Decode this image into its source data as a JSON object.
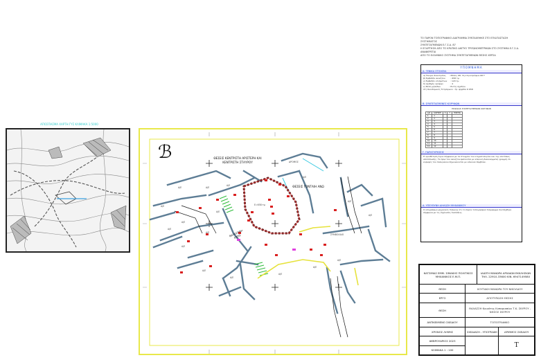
{
  "inset": {
    "title": "ΑΠΟΣΠΑΣΜΑ ΧΑΡΤΗ ΓΥΣ ΚΛΙΜΑΚΑ 1:5000"
  },
  "plan": {
    "north_arrow": "ℬ",
    "labels": {
      "area_west": "ΘΕΣΕΙΣ ΚΕΝΤΡΙΣΤΗ ΑΡΙΣΤΕΡΗ ΚΑΙ ΚΕΝΤΡΙΣΤΗ ΣΤΑΥΡΟΥ",
      "area_east": "ΘΕΣΕΙΣ ΓΟΝΤΑΙΗ ΑΝΩ",
      "street_south": "ΘΑΛΑΣΣΙΝΗ ΕΡΟΙΣ"
    }
  },
  "note_top": {
    "lines": [
      "ΤΟ ΠΑΡΟΝ ΤΟΠΟΓΡΑΦΙΚΟ ΔΙΑΓΡΑΜΜΑ ΣΥΝΤΑΧΘΗΚΕ ΣΤΟ ΕΓΚΑΤΑΣΤΑΣΗ ΣΥΣΤΗΜΑΤΟΣ",
      "ΣΥΝΤΕΤΑΓΜΕΝΩΝ Ε.Γ.Σ.Α. 87",
      "Η ΕΞΑΡΤΗΣΗ ΑΠΟ ΤΟ ΚΡΑΤΙΚΟ ΔΙΚΤΥΟ ΤΡΙΓΩΝΟΜΕΤΡΙΚΩΝ ΣΤΟ ΣΥΣΤΗΜΑ Ε.Γ.Σ.Α. ΑΝΑΦΕΡΕΤΑΙ",
      "ΑΠΟ ΤΟ ΕΛΛΗΝΙΚΟ ΣΥΣΤΗΜΑ ΣΥΝΤΕΤΑΓΜΕΝΩΝ ΘΕΣΗΣ ΧΕΡΣΑ"
    ]
  },
  "specs": {
    "title": "ΥΠΟΜΝΗΜΑ",
    "section1": "Α. ΓΕΝΙΚΑ ΣΤΟΙΧΕΙΑ",
    "section1_body": "α) Όνομα ιδιοκτησίας     : Μύλος 68, 3η κτηνοτρόφων 68 Τ\nβ) Εμβαδόν ακινήτου        : 658 τμ\nγ) Εμβαδόν κτισμάτων     : 120 τμ\nδ) Αριθμός ορόφων           : 2\nε) Θέση γηπέδου             : Εντός σχεδίου\nστ) Οικοδομικός Τετράγωνο : Γρ. ψηφίδα Ο 658",
    "section2": "Β. ΣΥΝΤΕΤΑΓΜΕΝΕΣ ΚΟΡΥΦΩΝ",
    "section2_sub": "ΠΙΝΑΚΑΣ ΣΥΝΤΕΤΑΓΜΕΝΩΝ ΚΟΡΥΦΩΝ",
    "coord_headers": [
      "Α/Α",
      "ΚΟΡΥΦΗ",
      "X",
      "Y",
      "ΠΛΕΥΡΑ"
    ],
    "coord_rows": [
      [
        "1",
        "1",
        "",
        "",
        ""
      ],
      [
        "2",
        "2",
        "",
        "",
        ""
      ],
      [
        "3",
        "3",
        "",
        "",
        ""
      ],
      [
        "4",
        "4",
        "",
        "",
        ""
      ],
      [
        "5",
        "5",
        "",
        "",
        ""
      ],
      [
        "6",
        "6",
        "",
        "",
        ""
      ],
      [
        "7",
        "7",
        "",
        "",
        ""
      ],
      [
        "8",
        "8",
        "",
        "",
        ""
      ],
      [
        "9",
        "9",
        "",
        "",
        ""
      ],
      [
        "10",
        "10",
        "",
        "",
        ""
      ],
      [
        "11",
        "11",
        "",
        "",
        ""
      ],
      [
        "12",
        "12",
        "",
        "",
        ""
      ]
    ],
    "section3": "Γ. ΠΑΡΑΤΗΡΗΣΕΙΣ",
    "section3_body": "Η οριοθέτηση έγινε σύμφωνα με τα στοιχεία του κτηματολογίου και της επιτόπιας αποτύπωσης. Τα όρια του ακινήτου φαίνονται με κόκκινη διακεκομμένη γραμμή. Οι κορυφές του πολυγώνου σημειώνονται με κόκκινα σύμβολα.",
    "section4": "Δ. ΥΠΕΥΘΥΝΗ ΔΗΛΩΣΗ ΜΗΧΑΝΙΚΟΥ",
    "section4_body": "Ο υπογράφων μηχανικός δηλώνω ότι το παρόν τοπογραφικό διάγραμμα συντάχθηκε σύμφωνα με τις ισχύουσες διατάξεις."
  },
  "title_block": {
    "engineer": "ΚΑΤΣΙΜΑΣ ΕΜΜ. ΣΙΜΑΚΗΣ ΠΟΛΙΤΙΚΟΣ ΜΗΧΑΝΙΚΟΣ Ε.Μ.Π.",
    "client": "ΙΔΙΩΤΗ ΜΑΝΩΡΑ ΑΡΧΑΙΩΝ ΕΚΚΛΗΣΙΩΝ ΤΗΛ. 22910-33600 ΚΙΝ. 6947149580",
    "rows": [
      {
        "label": "ΘΕΣΗ",
        "value": "ΧΟΥΤΑΚΗ ΜΑΝΩΡΑ ΤΟΥ ΝΙΚΟΛΑΟΥ"
      },
      {
        "label": "ΕΡΓΟ",
        "value": "ΑΠΟΤΥΠΩΣΗ ΘΕΣΗΣ"
      },
      {
        "label": "ΘΕΣΗ",
        "value": "ΘΑΛΑΣΣΗ Κοινότης Κυπαρισσίου Τ.Κ. ΣΚΥΡΟΥ - ΝΗΣΟΣ ΣΚΥΡΟΥ"
      },
      {
        "label": "ΑΝΤΙΚΕΙΜΕΝΟ ΣΧΕΔΙΟΥ",
        "value": "ΤΟΠΟΓΡΑΦΙΚΟ"
      }
    ],
    "date_label": "ΧΡΟΝΟΣ ΛΗΨΗΣ",
    "sign_label": "ΣΧΕΔΙΑΣΗ - ΥΠΟΓΡΑΦΗ",
    "drawing_no_label": "ΑΡΙΘΜΟΣ ΣΧΕΔΙΟΥ",
    "date_value": "ΦΕΒΡΟΥΑΡΙΟΣ 2023",
    "scale": "ΚΛΙΜΑΚΑ  1 : 100",
    "drawing_no": "T"
  }
}
